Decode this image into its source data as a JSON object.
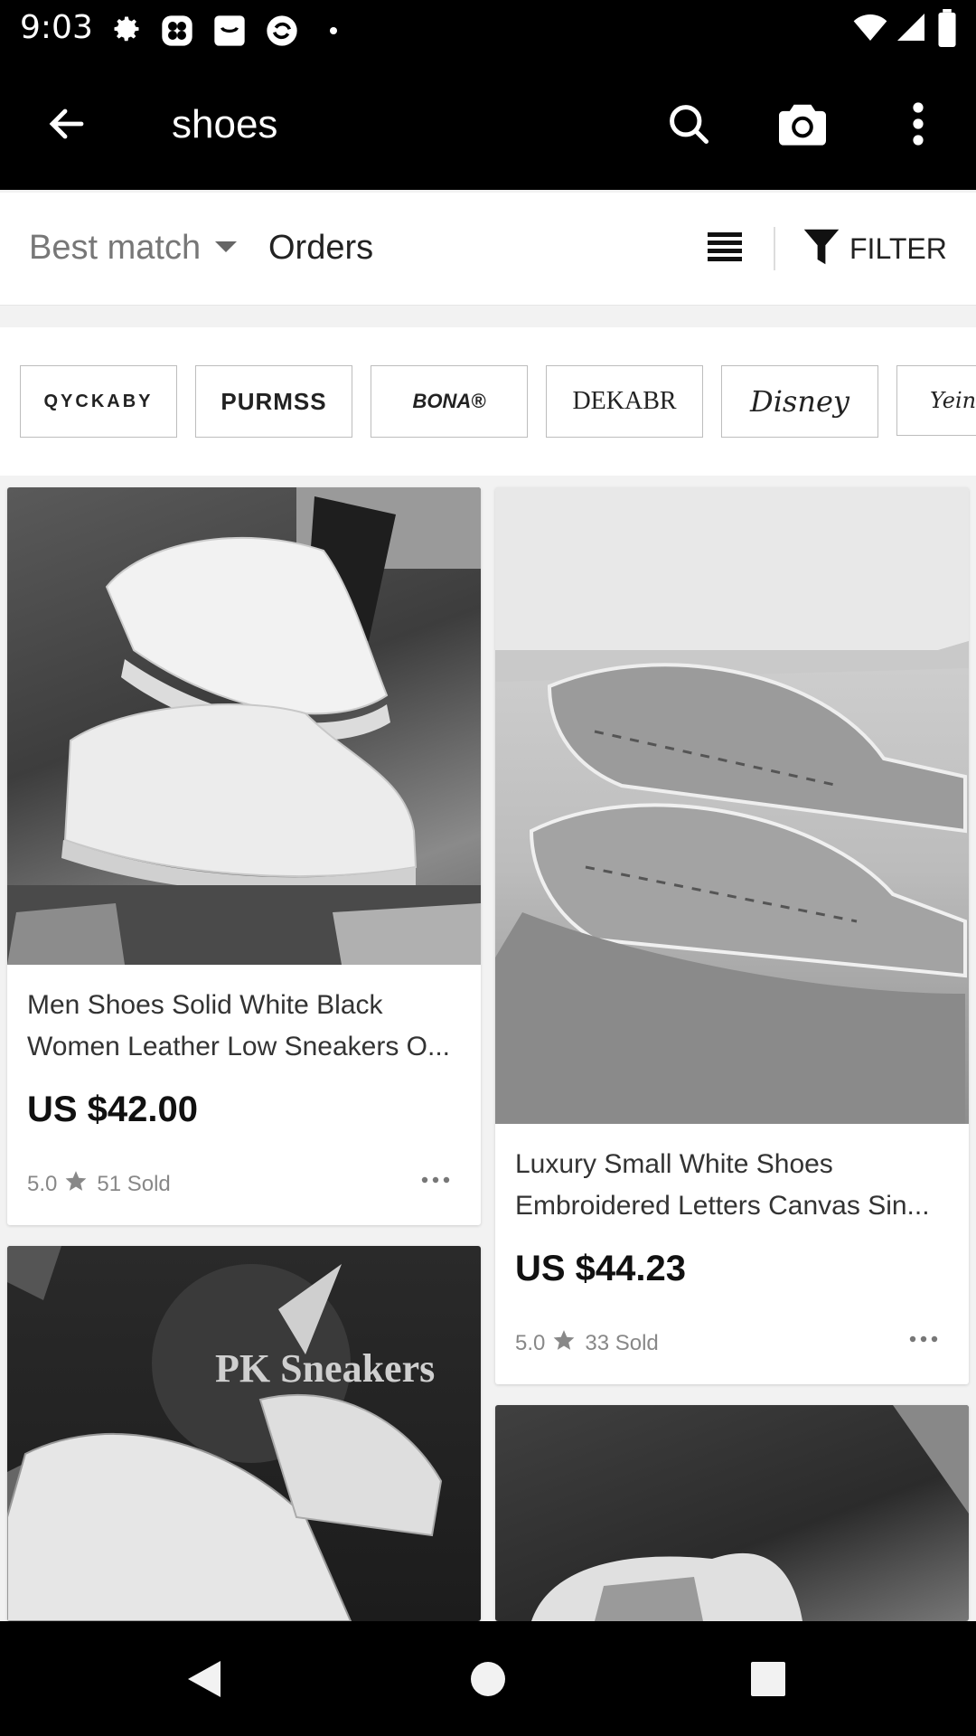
{
  "status_bar": {
    "time": "9:03",
    "left_icons": [
      "gear-icon",
      "grid-app-icon",
      "store-app-icon",
      "sync-app-icon",
      "dot-icon"
    ],
    "right_icons": [
      "wifi-icon",
      "signal-icon",
      "battery-icon"
    ]
  },
  "app_bar": {
    "query": "shoes",
    "icons": [
      "back-arrow-icon",
      "search-icon",
      "camera-icon",
      "more-vertical-icon"
    ]
  },
  "sort_bar": {
    "best_match": "Best match",
    "orders": "Orders",
    "filter": "FILTER"
  },
  "brands": [
    "QYCKABY",
    "PURMSS",
    "BONA®",
    "DEKABR",
    "Disney",
    "Yeins"
  ],
  "products": [
    {
      "title_line1": "Men Shoes Solid White Black",
      "title_line2": "Women Leather Low Sneakers O...",
      "price": "US $42.00",
      "rating": "5.0",
      "sold": "51 Sold"
    },
    {
      "title_line1": "Luxury Small White Shoes",
      "title_line2": "Embroidered Letters Canvas Sin...",
      "price": "US $44.23",
      "rating": "5.0",
      "sold": "33 Sold"
    },
    {
      "image_overlay_text": "PK Sneakers"
    },
    {}
  ],
  "colors": {
    "app_bar": "#000000",
    "background": "#f2f2f2",
    "card": "#ffffff",
    "muted_text": "#888888"
  }
}
